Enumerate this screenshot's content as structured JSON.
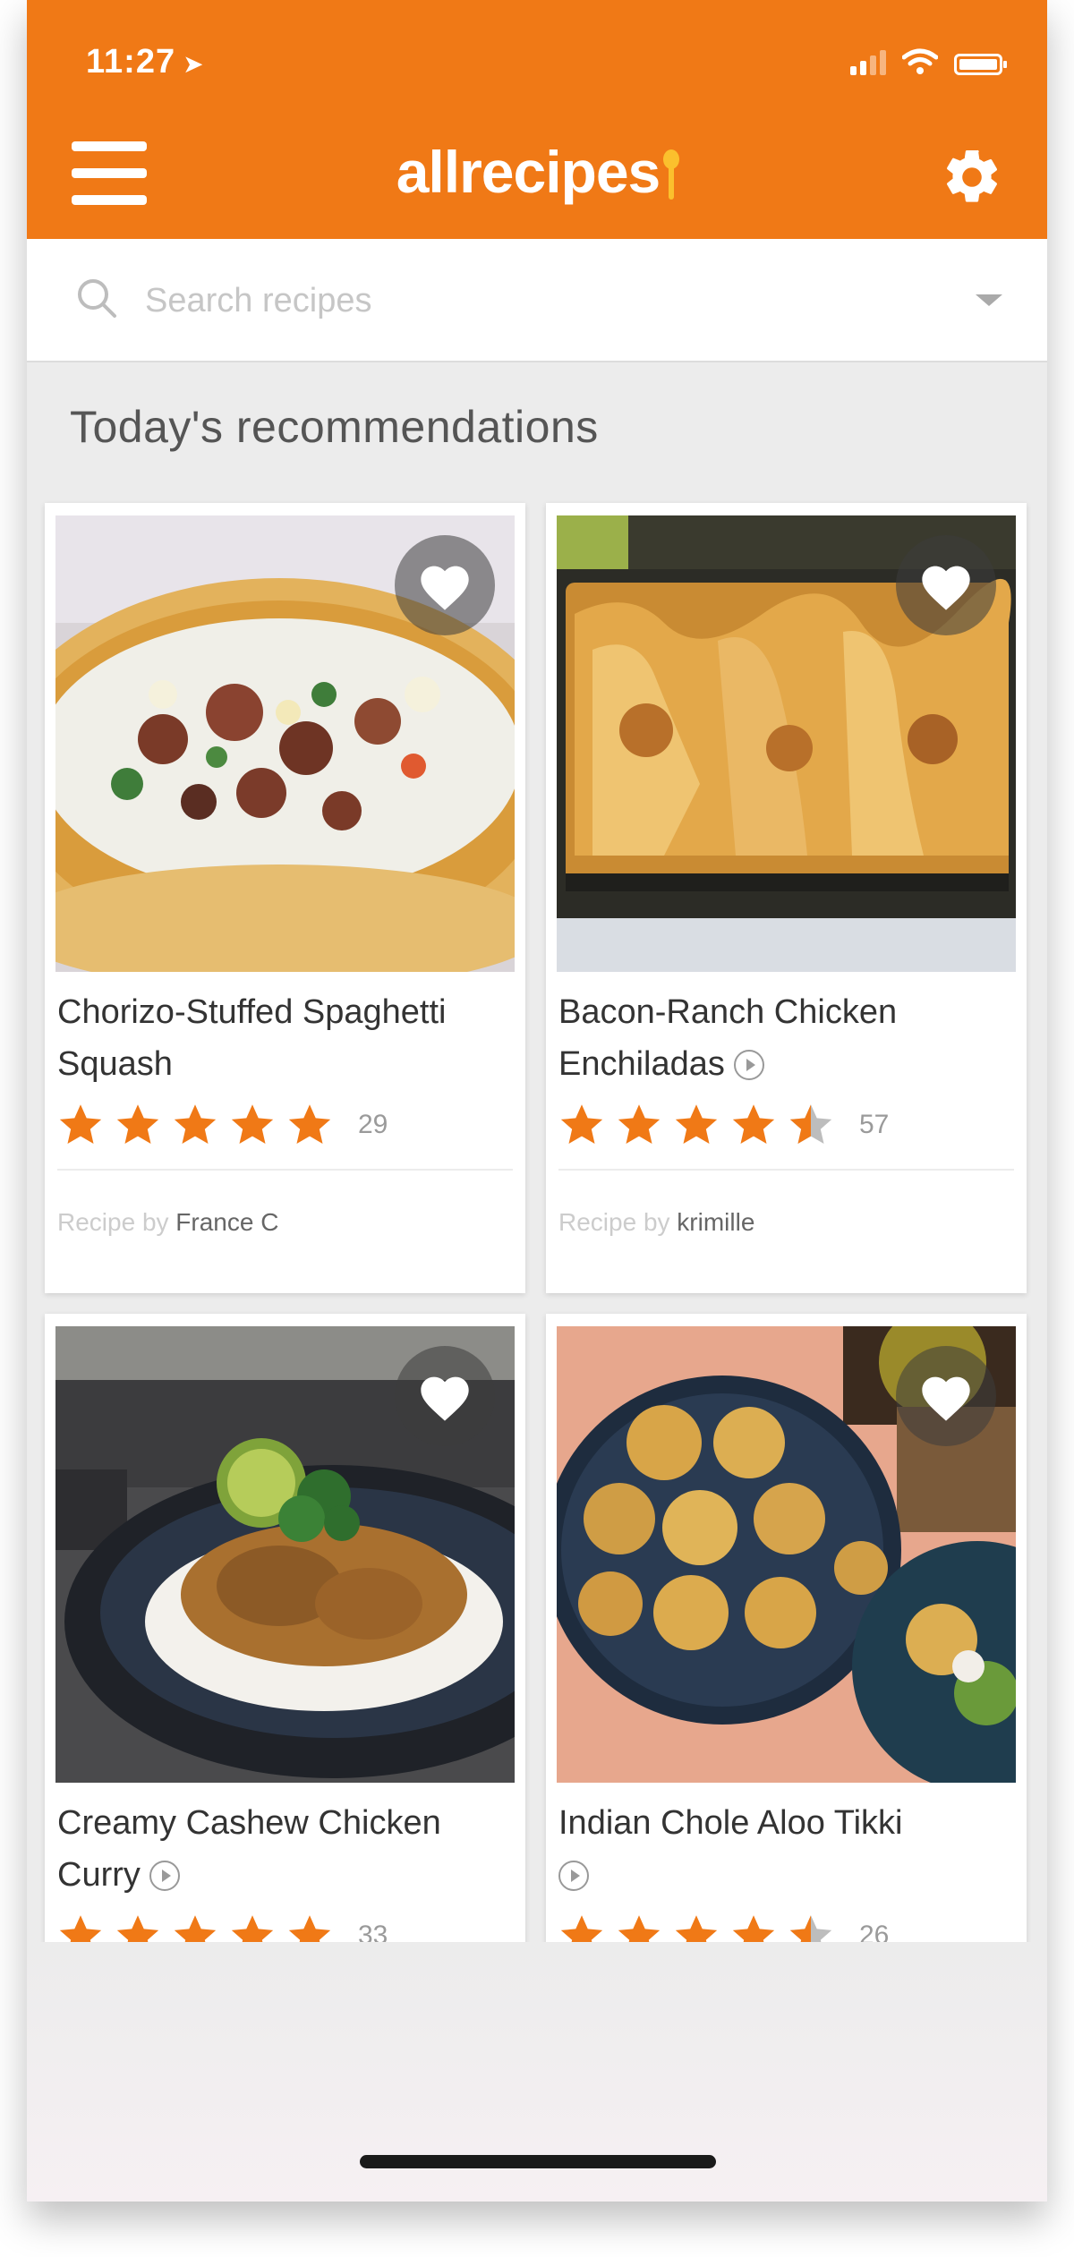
{
  "status_bar": {
    "time": "11:27",
    "location_icon": "location-arrow-icon"
  },
  "header": {
    "brand": "allrecipes",
    "menu_icon": "hamburger-menu-icon",
    "settings_icon": "gear-icon",
    "accent_color": "#f07916"
  },
  "search": {
    "placeholder": "Search recipes",
    "value": ""
  },
  "section_title": "Today's recommendations",
  "recipes": [
    {
      "title": "Chorizo-Stuffed Spaghetti Squash",
      "has_video": false,
      "rating": 5,
      "review_count": "29",
      "author_prefix": "Recipe by",
      "author": "France C"
    },
    {
      "title": "Bacon-Ranch Chicken Enchiladas",
      "has_video": true,
      "rating": 4.5,
      "review_count": "57",
      "author_prefix": "Recipe by",
      "author": "krimille"
    },
    {
      "title": "Creamy Cashew Chicken Curry",
      "has_video": true,
      "rating": 5,
      "review_count": "33"
    },
    {
      "title": "Indian Chole Aloo Tikki",
      "has_video": true,
      "rating": 4.5,
      "review_count": "26"
    }
  ],
  "star_color": "#f07916"
}
